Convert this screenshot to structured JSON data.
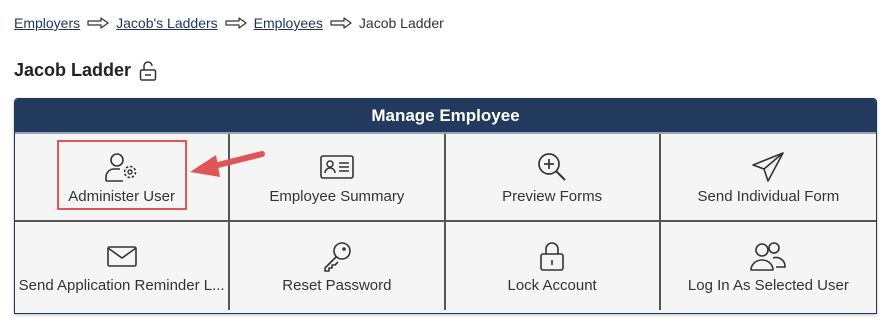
{
  "breadcrumb": {
    "items": [
      {
        "label": "Employers",
        "link": true
      },
      {
        "label": "Jacob's Ladders",
        "link": true
      },
      {
        "label": "Employees",
        "link": true
      },
      {
        "label": "Jacob Ladder",
        "link": false
      }
    ],
    "separator_icon": "right-arrow-icon"
  },
  "page": {
    "title": "Jacob Ladder",
    "title_icon": "unlocked-padlock-icon"
  },
  "panel": {
    "header": "Manage Employee",
    "header_color": "#233a5f",
    "tiles": [
      {
        "label": "Administer User",
        "icon": "user-gear-icon",
        "highlighted": true
      },
      {
        "label": "Employee Summary",
        "icon": "id-card-icon"
      },
      {
        "label": "Preview Forms",
        "icon": "zoom-in-icon"
      },
      {
        "label": "Send Individual Form",
        "icon": "paper-plane-icon"
      },
      {
        "label": "Send Application Reminder L...",
        "icon": "envelope-icon"
      },
      {
        "label": "Reset Password",
        "icon": "key-icon"
      },
      {
        "label": "Lock Account",
        "icon": "padlock-icon"
      },
      {
        "label": "Log In As Selected User",
        "icon": "users-icon"
      }
    ]
  },
  "annotation": {
    "highlight_color": "#e05656",
    "arrow_color": "#e05656"
  }
}
